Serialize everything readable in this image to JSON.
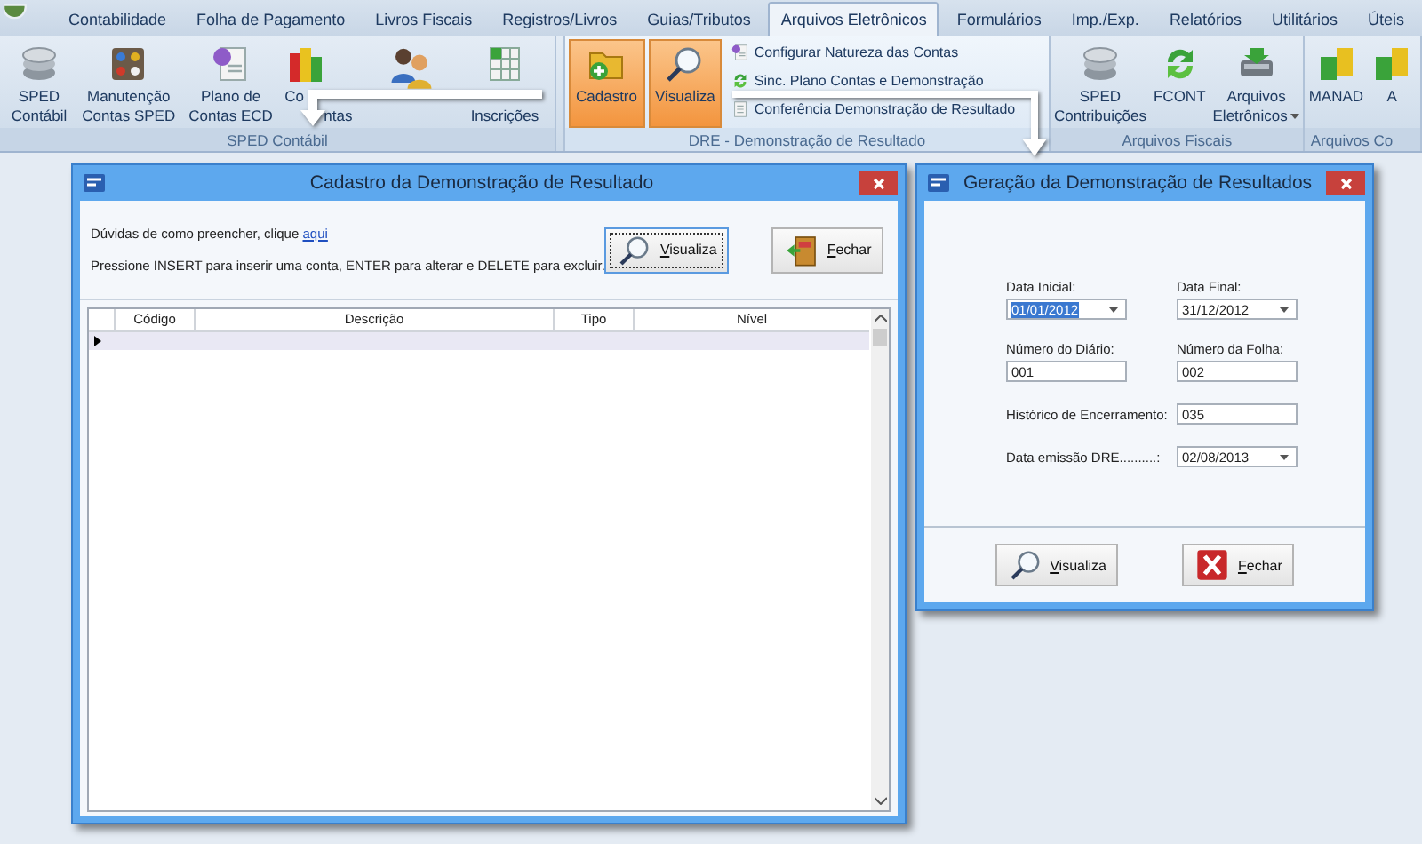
{
  "app_tabs": [
    {
      "label": "Contabilidade",
      "selected": false
    },
    {
      "label": "Folha de Pagamento",
      "selected": false
    },
    {
      "label": "Livros Fiscais",
      "selected": false
    },
    {
      "label": "Registros/Livros",
      "selected": false
    },
    {
      "label": "Guias/Tributos",
      "selected": false
    },
    {
      "label": "Arquivos Eletrônicos",
      "selected": true
    },
    {
      "label": "Formulários",
      "selected": false
    },
    {
      "label": "Imp./Exp.",
      "selected": false
    },
    {
      "label": "Relatórios",
      "selected": false
    },
    {
      "label": "Utilitários",
      "selected": false
    },
    {
      "label": "Úteis",
      "selected": false
    }
  ],
  "ribbon": {
    "groups": [
      {
        "title": "SPED Contábil",
        "active": false,
        "large_items": [
          {
            "line1": "SPED",
            "line2": "Contábil"
          },
          {
            "line1": "Manutenção",
            "line2": "Contas SPED"
          },
          {
            "line1": "Plano de",
            "line2": "Contas ECD"
          },
          {
            "line1": "Co",
            "line2": "ntas"
          },
          {
            "kind": "icon"
          },
          {
            "line2": "Inscrições"
          }
        ]
      },
      {
        "title": "DRE - Demonstração de Resultado",
        "active": true,
        "large_items": [
          {
            "line1": "Cadastro",
            "highlighted": true
          },
          {
            "line1": "Visualiza",
            "highlighted": true
          }
        ],
        "small_items": [
          {
            "label": "Configurar Natureza das Contas"
          },
          {
            "label": "Sinc. Plano Contas e Demonstração"
          },
          {
            "label": "Conferência Demonstração de Resultado"
          }
        ]
      },
      {
        "title": "Arquivos Fiscais",
        "active": false,
        "large_items": [
          {
            "line1": "SPED",
            "line2": "Contribuições"
          },
          {
            "line1": "FCONT"
          },
          {
            "line1": "Arquivos",
            "line2": "Eletrônicos",
            "dropdown": true
          }
        ]
      },
      {
        "title": "Arquivos Co",
        "active": false,
        "large_items": [
          {
            "line1": "MANAD"
          },
          {
            "line1": "A"
          }
        ]
      }
    ]
  },
  "cadastro_window": {
    "title": "Cadastro da Demonstração de Resultado",
    "help_text": "Dúvidas de como preencher, clique ",
    "help_link": "aqui",
    "instructions": "Pressione INSERT para inserir uma conta, ENTER para alterar e DELETE para excluir.",
    "buttons": [
      {
        "label": "Visualiza",
        "focused": true
      },
      {
        "label": "Fechar",
        "focused": false
      }
    ],
    "table": {
      "columns": [
        "Código",
        "Descrição",
        "Tipo",
        "Nível"
      ],
      "rows": [
        {
          "current": true
        }
      ]
    }
  },
  "geracao_window": {
    "title": "Geração da Demonstração de Resultados",
    "fields": [
      {
        "label": "Data Inicial:",
        "value": "01/01/2012",
        "kind": "dropdown",
        "text_selected": true
      },
      {
        "label": "Data Final:",
        "value": "31/12/2012",
        "kind": "dropdown",
        "text_selected": false
      },
      {
        "label": "Número do Diário:",
        "value": "001",
        "kind": "text",
        "text_selected": false
      },
      {
        "label": "Número da Folha:",
        "value": "002",
        "kind": "text",
        "text_selected": false
      },
      {
        "label": "Histórico de Encerramento:",
        "value": "035",
        "kind": "text",
        "text_selected": false
      },
      {
        "label": "Data emissão DRE..........:",
        "value": "02/08/2013",
        "kind": "dropdown",
        "text_selected": false
      }
    ],
    "buttons": [
      {
        "label": "Visualiza",
        "focused": false
      },
      {
        "label": "Fechar",
        "focused": false
      }
    ]
  }
}
